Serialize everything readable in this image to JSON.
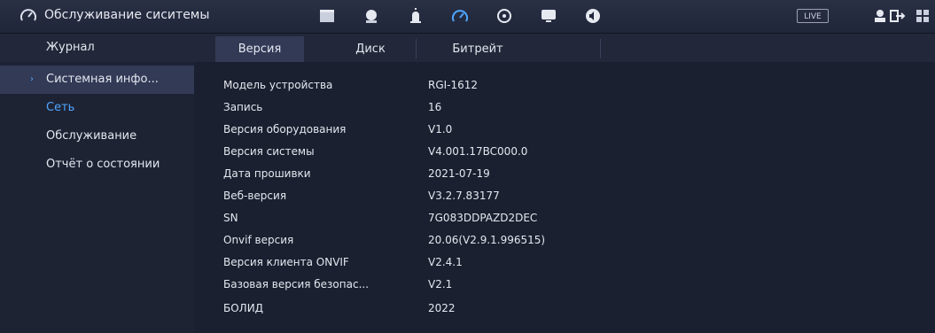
{
  "header": {
    "title": "Обслуживание сиситемы",
    "live_label": "LIVE",
    "icons": [
      "gauge-icon",
      "camera-icon",
      "face-icon",
      "alarm-light-icon",
      "gauge-active-icon",
      "disk-icon",
      "monitor-icon",
      "audio-icon",
      "user-icon",
      "logout-icon",
      "grid-icon"
    ]
  },
  "sidebar": {
    "items": [
      {
        "label": "Журнал"
      },
      {
        "label": "Системная инфо..."
      },
      {
        "label": "Сеть"
      },
      {
        "label": "Обслуживание"
      },
      {
        "label": "Отчёт о состоянии"
      }
    ]
  },
  "tabs": [
    {
      "label": "Версия"
    },
    {
      "label": "Диск"
    },
    {
      "label": "Битрейт"
    }
  ],
  "info": [
    {
      "label": "Модель устройства",
      "value": "RGI-1612"
    },
    {
      "label": "Запись",
      "value": "16"
    },
    {
      "label": "Версия оборудования",
      "value": "V1.0"
    },
    {
      "label": "Версия системы",
      "value": "V4.001.17BC000.0"
    },
    {
      "label": "Дата прошивки",
      "value": "2021-07-19"
    },
    {
      "label": "Веб-версия",
      "value": "V3.2.7.83177"
    },
    {
      "label": "SN",
      "value": "7G083DDPAZD2DEC"
    },
    {
      "label": "Onvif версия",
      "value": "20.06(V2.9.1.996515)"
    },
    {
      "label": "Версия клиента ONVIF",
      "value": "V2.4.1"
    },
    {
      "label": "Базовая версия безопас...",
      "value": "V2.1"
    },
    {
      "label": "БОЛИД",
      "value": "2022"
    }
  ],
  "colors": {
    "accent": "#4fa6ff",
    "background": "#1b2030",
    "active_tab": "#323a56"
  }
}
